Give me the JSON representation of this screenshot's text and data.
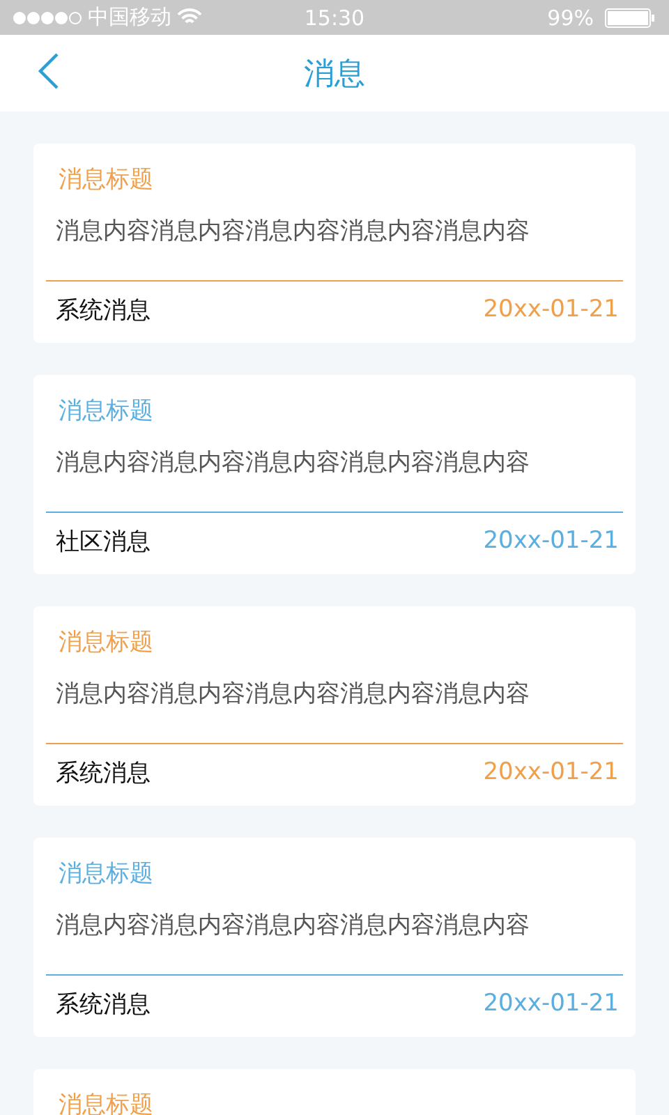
{
  "status_bar": {
    "carrier": "中国移动",
    "time": "15:30",
    "battery": "99%"
  },
  "nav": {
    "title": "消息"
  },
  "messages": [
    {
      "title": "消息标题",
      "content": "消息内容消息内容消息内容消息内容消息内容",
      "category": "系统消息",
      "date": "20xx-01-21",
      "color": "#f0a04b"
    },
    {
      "title": "消息标题",
      "content": "消息内容消息内容消息内容消息内容消息内容",
      "category": "社区消息",
      "date": "20xx-01-21",
      "color": "#5aafe0"
    },
    {
      "title": "消息标题",
      "content": "消息内容消息内容消息内容消息内容消息内容",
      "category": "系统消息",
      "date": "20xx-01-21",
      "color": "#f0a04b"
    },
    {
      "title": "消息标题",
      "content": "消息内容消息内容消息内容消息内容消息内容",
      "category": "系统消息",
      "date": "20xx-01-21",
      "color": "#5aafe0"
    },
    {
      "title": "消息标题",
      "color": "#f0a04b"
    }
  ]
}
